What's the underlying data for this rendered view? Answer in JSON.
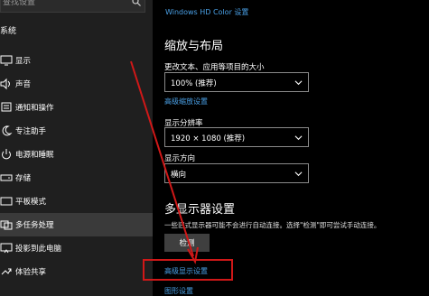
{
  "sidebar": {
    "search_placeholder": "查找设置",
    "section_title": "系统",
    "items": [
      {
        "label": "显示",
        "icon": "monitor-icon"
      },
      {
        "label": "声音",
        "icon": "speaker-icon"
      },
      {
        "label": "通知和操作",
        "icon": "notification-icon"
      },
      {
        "label": "专注助手",
        "icon": "moon-icon"
      },
      {
        "label": "电源和睡眠",
        "icon": "power-icon"
      },
      {
        "label": "存储",
        "icon": "storage-icon"
      },
      {
        "label": "平板模式",
        "icon": "tablet-icon"
      },
      {
        "label": "多任务处理",
        "icon": "multitask-icon"
      },
      {
        "label": "投影到此电脑",
        "icon": "project-icon"
      },
      {
        "label": "体验共享",
        "icon": "share-icon"
      }
    ]
  },
  "main": {
    "hd_color_link": "Windows HD Color 设置",
    "scale_heading": "缩放与布局",
    "scale_label": "更改文本、应用等项目的大小",
    "scale_value": "100% (推荐)",
    "advanced_scaling_link": "高级缩放设置",
    "resolution_label": "显示分辨率",
    "resolution_value": "1920 × 1080 (推荐)",
    "orientation_label": "显示方向",
    "orientation_value": "横向",
    "multi_heading": "多显示器设置",
    "multi_desc": "一些旧式显示器可能不会进行自动连接。选择\"检测\"即可尝试手动连接。",
    "detect_button": "检测",
    "advanced_display_link": "高级显示设置",
    "graphics_link": "图形设置"
  },
  "colors": {
    "accent": "#4aa0e6",
    "annotation": "#d01818"
  }
}
